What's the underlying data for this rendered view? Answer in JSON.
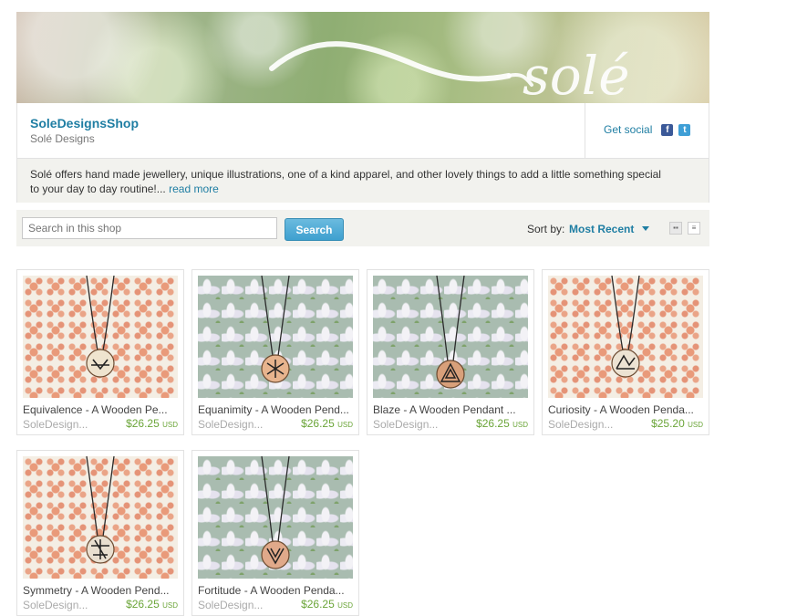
{
  "banner": {
    "logo_text": "solé"
  },
  "shop": {
    "name": "SoleDesignsShop",
    "subtitle": "Solé Designs",
    "social_label": "Get social",
    "about": "Solé offers hand made jewellery, unique illustrations, one of a kind apparel, and other lovely things to add a little something special to your day to day routine!...",
    "read_more": "read more"
  },
  "search": {
    "placeholder": "Search in this shop",
    "button": "Search",
    "sort_label": "Sort by:",
    "sort_value": "Most Recent"
  },
  "icons": {
    "facebook": "facebook-icon",
    "twitter": "twitter-icon",
    "grid_view": "grid-view-icon",
    "list_view": "list-view-icon"
  },
  "listings": [
    {
      "title": "Equivalence - A Wooden Pe...",
      "shop": "SoleDesign...",
      "price": "$26.25",
      "currency": "USD",
      "background": "peach"
    },
    {
      "title": "Equanimity - A Wooden Pend...",
      "shop": "SoleDesign...",
      "price": "$26.25",
      "currency": "USD",
      "background": "blue"
    },
    {
      "title": "Blaze - A Wooden Pendant ...",
      "shop": "SoleDesign...",
      "price": "$26.25",
      "currency": "USD",
      "background": "blue"
    },
    {
      "title": "Curiosity - A Wooden Penda...",
      "shop": "SoleDesign...",
      "price": "$25.20",
      "currency": "USD",
      "background": "peach"
    },
    {
      "title": "Symmetry - A Wooden Pend...",
      "shop": "SoleDesign...",
      "price": "$26.25",
      "currency": "USD",
      "background": "peach"
    },
    {
      "title": "Fortitude - A Wooden Penda...",
      "shop": "SoleDesign...",
      "price": "$26.25",
      "currency": "USD",
      "background": "blue"
    }
  ]
}
